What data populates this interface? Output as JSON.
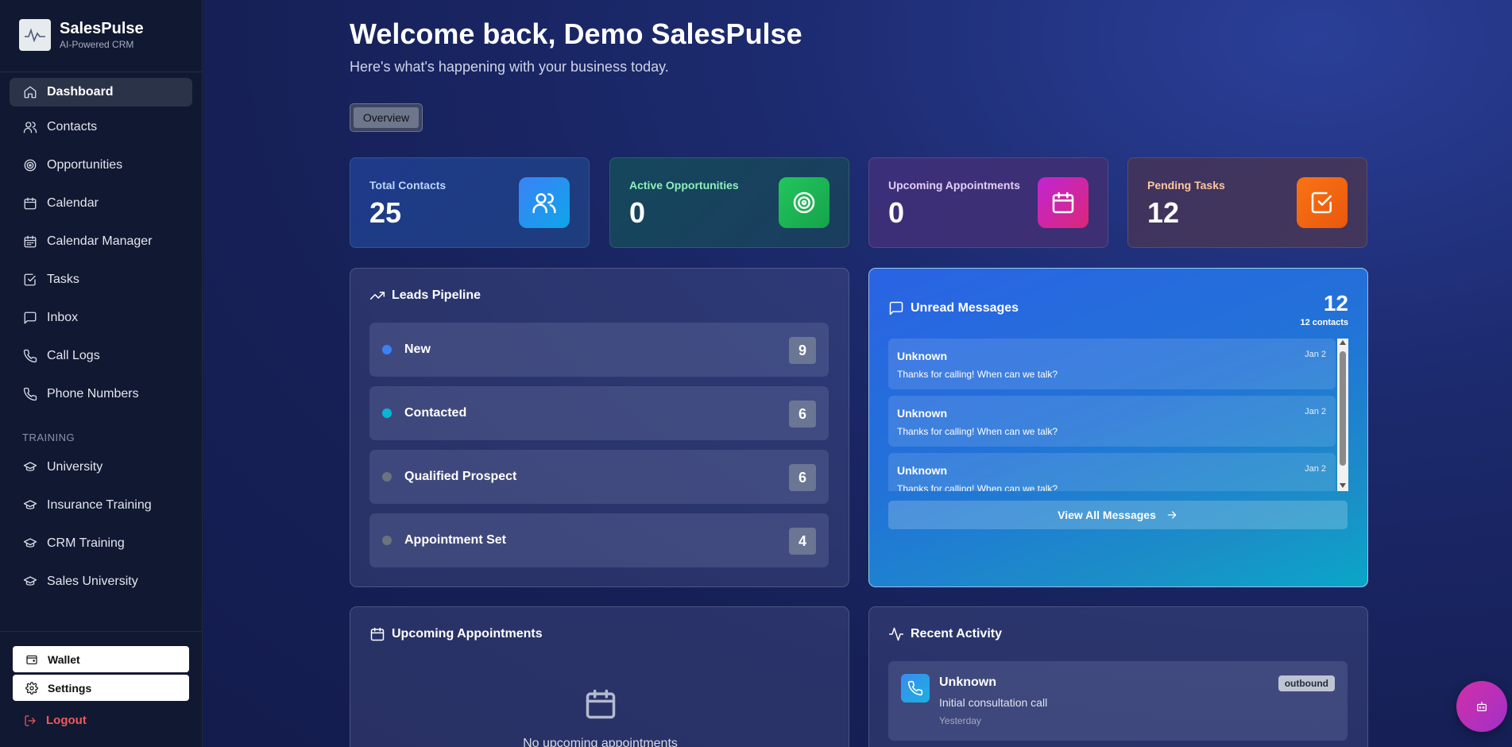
{
  "brand": {
    "name": "SalesPulse",
    "tagline": "AI-Powered CRM",
    "logo_icon": "pulse-logo-icon"
  },
  "sidebar": {
    "items": [
      {
        "label": "Dashboard",
        "icon": "home-icon",
        "active": true
      },
      {
        "label": "Contacts",
        "icon": "users-icon"
      },
      {
        "label": "Opportunities",
        "icon": "target-icon"
      },
      {
        "label": "Calendar",
        "icon": "calendar-icon"
      },
      {
        "label": "Calendar Manager",
        "icon": "calendar-grid-icon"
      },
      {
        "label": "Tasks",
        "icon": "check-square-icon"
      },
      {
        "label": "Inbox",
        "icon": "message-icon"
      },
      {
        "label": "Call Logs",
        "icon": "phone-icon"
      },
      {
        "label": "Phone Numbers",
        "icon": "phone-icon"
      }
    ],
    "section_training": "TRAINING",
    "training_items": [
      {
        "label": "University",
        "icon": "graduation-cap-icon"
      },
      {
        "label": "Insurance Training",
        "icon": "graduation-cap-icon"
      },
      {
        "label": "CRM Training",
        "icon": "graduation-cap-icon"
      },
      {
        "label": "Sales University",
        "icon": "graduation-cap-icon"
      }
    ],
    "wallet_label": "Wallet",
    "settings_label": "Settings",
    "logout_label": "Logout"
  },
  "header": {
    "welcome": "Welcome back, Demo SalesPulse",
    "subtitle": "Here's what's happening with your business today.",
    "tab_overview": "Overview"
  },
  "stats": [
    {
      "label": "Total Contacts",
      "value": "25",
      "icon": "users-icon",
      "label_color": "#bcd4ff"
    },
    {
      "label": "Active Opportunities",
      "value": "0",
      "icon": "target-icon",
      "label_color": "#8ef0bd"
    },
    {
      "label": "Upcoming Appointments",
      "value": "0",
      "icon": "calendar-icon",
      "label_color": "#e4cdf7"
    },
    {
      "label": "Pending Tasks",
      "value": "12",
      "icon": "check-square-icon",
      "label_color": "#ffc79e"
    }
  ],
  "pipeline": {
    "title": "Leads Pipeline",
    "stages": [
      {
        "name": "New",
        "count": "9",
        "dot_color": "#3b82f6"
      },
      {
        "name": "Contacted",
        "count": "6",
        "dot_color": "#06b6d4"
      },
      {
        "name": "Qualified Prospect",
        "count": "6",
        "dot_color": "#6b7280"
      },
      {
        "name": "Appointment Set",
        "count": "4",
        "dot_color": "#6b7280"
      }
    ]
  },
  "unread": {
    "title": "Unread Messages",
    "count": "12",
    "contacts_label": "12 contacts",
    "messages": [
      {
        "name": "Unknown",
        "date": "Jan 2",
        "text": "Thanks for calling! When can we talk?"
      },
      {
        "name": "Unknown",
        "date": "Jan 2",
        "text": "Thanks for calling! When can we talk?"
      },
      {
        "name": "Unknown",
        "date": "Jan 2",
        "text": "Thanks for calling! When can we talk?"
      }
    ],
    "view_all_label": "View All Messages"
  },
  "appointments": {
    "title": "Upcoming Appointments",
    "empty_text": "No upcoming appointments"
  },
  "activity": {
    "title": "Recent Activity",
    "items": [
      {
        "name": "Unknown",
        "desc": "Initial consultation call",
        "time": "Yesterday",
        "badge": "outbound",
        "icon": "phone-icon"
      }
    ]
  },
  "fab": {
    "icon": "bot-icon"
  }
}
